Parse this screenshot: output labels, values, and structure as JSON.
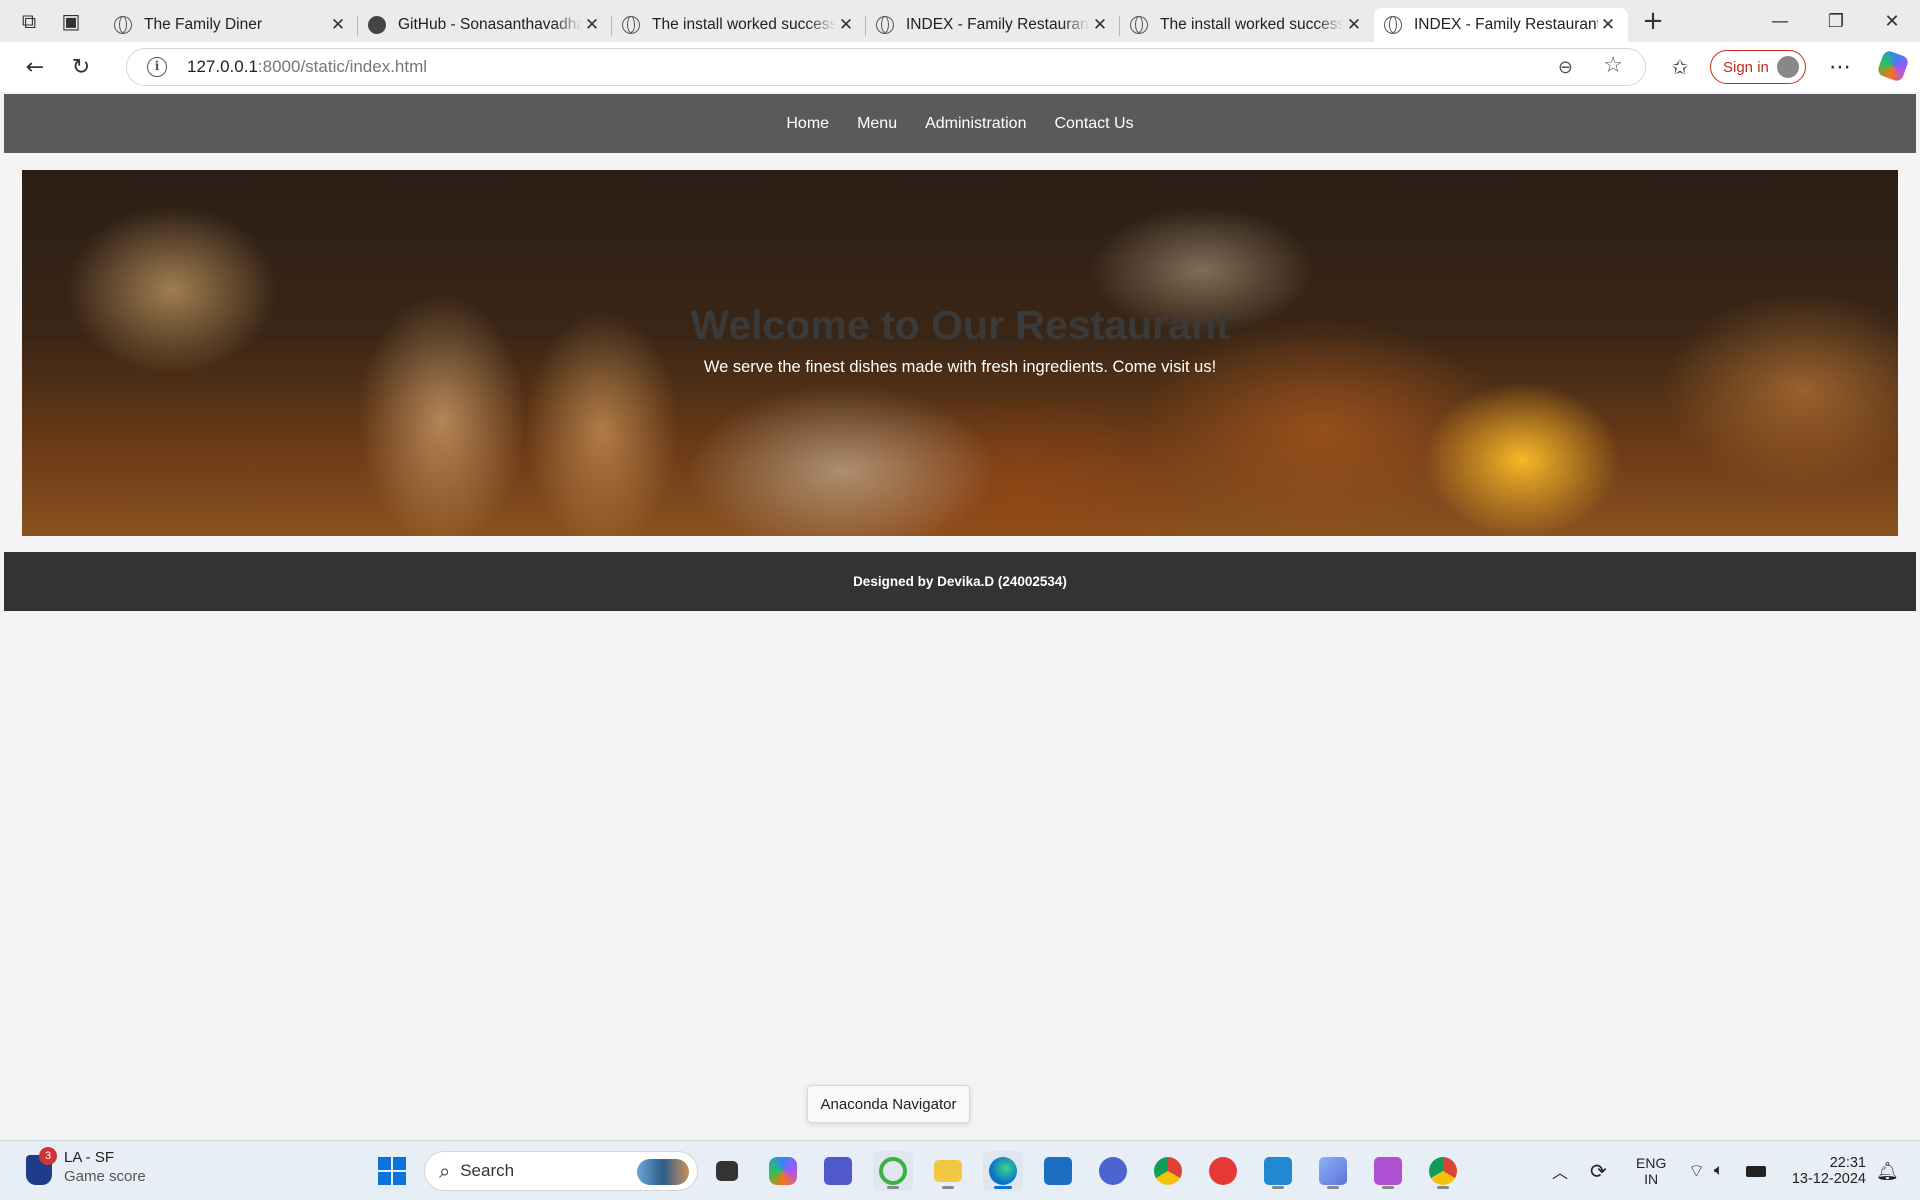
{
  "browser": {
    "tabs": [
      {
        "title": "The Family Diner",
        "icon": "globe-icon",
        "active": false
      },
      {
        "title": "GitHub - Sonasanthavadhani",
        "icon": "github-icon",
        "active": false
      },
      {
        "title": "The install worked successfully",
        "icon": "globe-icon",
        "active": false
      },
      {
        "title": "INDEX - Family Restaurant",
        "icon": "globe-icon",
        "active": false
      },
      {
        "title": "The install worked successfully",
        "icon": "globe-icon",
        "active": false
      },
      {
        "title": "INDEX - Family Restaurant",
        "icon": "globe-icon",
        "active": true
      }
    ],
    "url_host": "127.0.0.1",
    "url_rest": ":8000/static/index.html",
    "sign_in_label": "Sign in"
  },
  "site": {
    "nav": [
      "Home",
      "Menu",
      "Administration",
      "Contact Us"
    ],
    "hero_title": "Welcome to Our Restaurant",
    "hero_subtitle": "We serve the finest dishes made with fresh ingredients. Come visit us!",
    "footer_text": "Designed by Devika.D (24002534)"
  },
  "tooltip": "Anaconda Navigator",
  "taskbar": {
    "widget_badge": "3",
    "widget_line1": "LA - SF",
    "widget_line2": "Game score",
    "search_label": "Search",
    "lang_line1": "ENG",
    "lang_line2": "IN",
    "time": "22:31",
    "date": "13-12-2024"
  },
  "colors": {
    "site_nav_bg": "#5a5a5a",
    "footer_bg": "#333333",
    "signin_accent": "#c42b1c",
    "windows_blue": "#0a74da"
  }
}
